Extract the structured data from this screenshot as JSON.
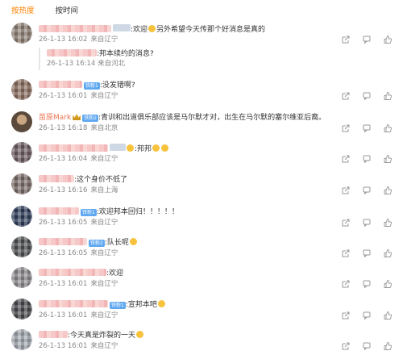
{
  "tabs": [
    "按热度",
    "按时间"
  ],
  "comments": [
    {
      "name": "",
      "vip": "",
      "text": ":欢迎",
      "emoji1": true,
      "text2": "另外希望今天传那个好消息是真的",
      "date": "26-1-13 16:02",
      "loc": "来自辽宁",
      "reply": {
        "text": ":邦本续约的消息?",
        "date": "26-1-13 16:14",
        "loc": "来自河北"
      }
    },
    {
      "name": "",
      "vip": "铁粉1",
      "text": ":没发错啊?",
      "date": "26-1-13 16:01",
      "loc": "来自辽宁"
    },
    {
      "name": "苗原Mark",
      "vip": "铁粉2",
      "text": ":青训和出道俱乐部应该是马尔默才对，出生在马尔默的塞尔维亚后裔。",
      "date": "26-1-13 16:18",
      "loc": "来自北京"
    },
    {
      "name": "",
      "vip": "",
      "text": ":邦邦",
      "date": "26-1-13 16:04",
      "loc": "来自辽宁"
    },
    {
      "name": "",
      "vip": "",
      "text": ":这个身价不低了",
      "date": "26-1-13 16:16",
      "loc": "来自上海"
    },
    {
      "name": "",
      "vip": "铁粉1",
      "text": ":欢迎邦本回归！！！！！",
      "date": "26-1-13 16:05",
      "loc": "来自辽宁"
    },
    {
      "name": "",
      "vip": "铁粉2",
      "text": ":队长呢",
      "date": "26-1-13 16:05",
      "loc": "来自辽宁"
    },
    {
      "name": "",
      "vip": "",
      "text": ":欢迎",
      "date": "26-1-13 16:01",
      "loc": "来自辽宁"
    },
    {
      "name": "",
      "vip": "铁粉1",
      "text": ":宣邦本吧",
      "date": "26-1-13 16:01",
      "loc": "来自辽宁"
    },
    {
      "name": "",
      "vip": "",
      "text": ":今天真是炸裂的一天",
      "date": "26-1-13 16:01",
      "loc": "来自辽宁"
    }
  ],
  "colors": {
    "accent": "#ff8200",
    "name": "#eb7350",
    "meta": "#888888",
    "vip": "#5fa8f0"
  },
  "icons": [
    "share-icon",
    "comment-icon",
    "like-icon"
  ]
}
